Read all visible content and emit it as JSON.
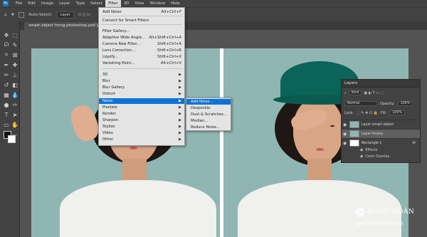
{
  "app": {
    "logo_text": "Ps",
    "menu": [
      "File",
      "Edit",
      "Image",
      "Layer",
      "Type",
      "Select",
      "Filter",
      "3D",
      "View",
      "Window",
      "Help"
    ],
    "active_menu": "Filter"
  },
  "options_bar": {
    "auto_select_label": "Auto-Select:",
    "layer_select": "Layer",
    "mode_3d_label": "3D Mode:"
  },
  "document": {
    "tab_title": "smart-object trong photoshop.psd @ 66.7% (Layer thumb, RGB/8) *"
  },
  "filter_menu": {
    "items": [
      {
        "label": "Add Noise",
        "shortcut": "Alt+Ctrl+F"
      },
      {
        "label": "Convert for Smart Filters",
        "shortcut": ""
      },
      {
        "label": "Filter Gallery...",
        "shortcut": ""
      },
      {
        "label": "Adaptive Wide Angle...",
        "shortcut": "Alt+Shift+Ctrl+A"
      },
      {
        "label": "Camera Raw Filter...",
        "shortcut": "Shift+Ctrl+A"
      },
      {
        "label": "Lens Correction...",
        "shortcut": "Shift+Ctrl+R"
      },
      {
        "label": "Liquify...",
        "shortcut": "Shift+Ctrl+X"
      },
      {
        "label": "Vanishing Point...",
        "shortcut": "Alt+Ctrl+V"
      },
      {
        "label": "3D",
        "shortcut": ""
      },
      {
        "label": "Blur",
        "shortcut": ""
      },
      {
        "label": "Blur Gallery",
        "shortcut": ""
      },
      {
        "label": "Distort",
        "shortcut": ""
      },
      {
        "label": "Noise",
        "shortcut": ""
      },
      {
        "label": "Pixelate",
        "shortcut": ""
      },
      {
        "label": "Render",
        "shortcut": ""
      },
      {
        "label": "Sharpen",
        "shortcut": ""
      },
      {
        "label": "Stylize",
        "shortcut": ""
      },
      {
        "label": "Video",
        "shortcut": ""
      },
      {
        "label": "Other",
        "shortcut": ""
      }
    ],
    "highlighted": "Noise"
  },
  "noise_submenu": {
    "items": [
      "Add Noise...",
      "Despeckle",
      "Dust & Scratches...",
      "Median...",
      "Reduce Noise..."
    ],
    "highlighted": "Add Noise..."
  },
  "layers_panel": {
    "title": "Layers",
    "kind_label": "Kind",
    "blend_mode": "Normal",
    "opacity_label": "Opacity:",
    "opacity_value": "100%",
    "lock_label": "Lock:",
    "fill_label": "Fill:",
    "fill_value": "100%",
    "layers": [
      {
        "name": "Layer smart object",
        "selected": false
      },
      {
        "name": "Layer thumy",
        "selected": true
      },
      {
        "name": "Rectangle 1",
        "selected": false
      }
    ],
    "effects_label": "Effects",
    "effect_item": "Color Overlay",
    "fx_label": "fx"
  },
  "watermark": {
    "name": "NGỌC HOÀN",
    "site": "ngochoandesign.com"
  },
  "colors": {
    "canvas_bg": "#8fb6b2",
    "hat": "#0a6458",
    "menu_highlight": "#0d72d4"
  }
}
